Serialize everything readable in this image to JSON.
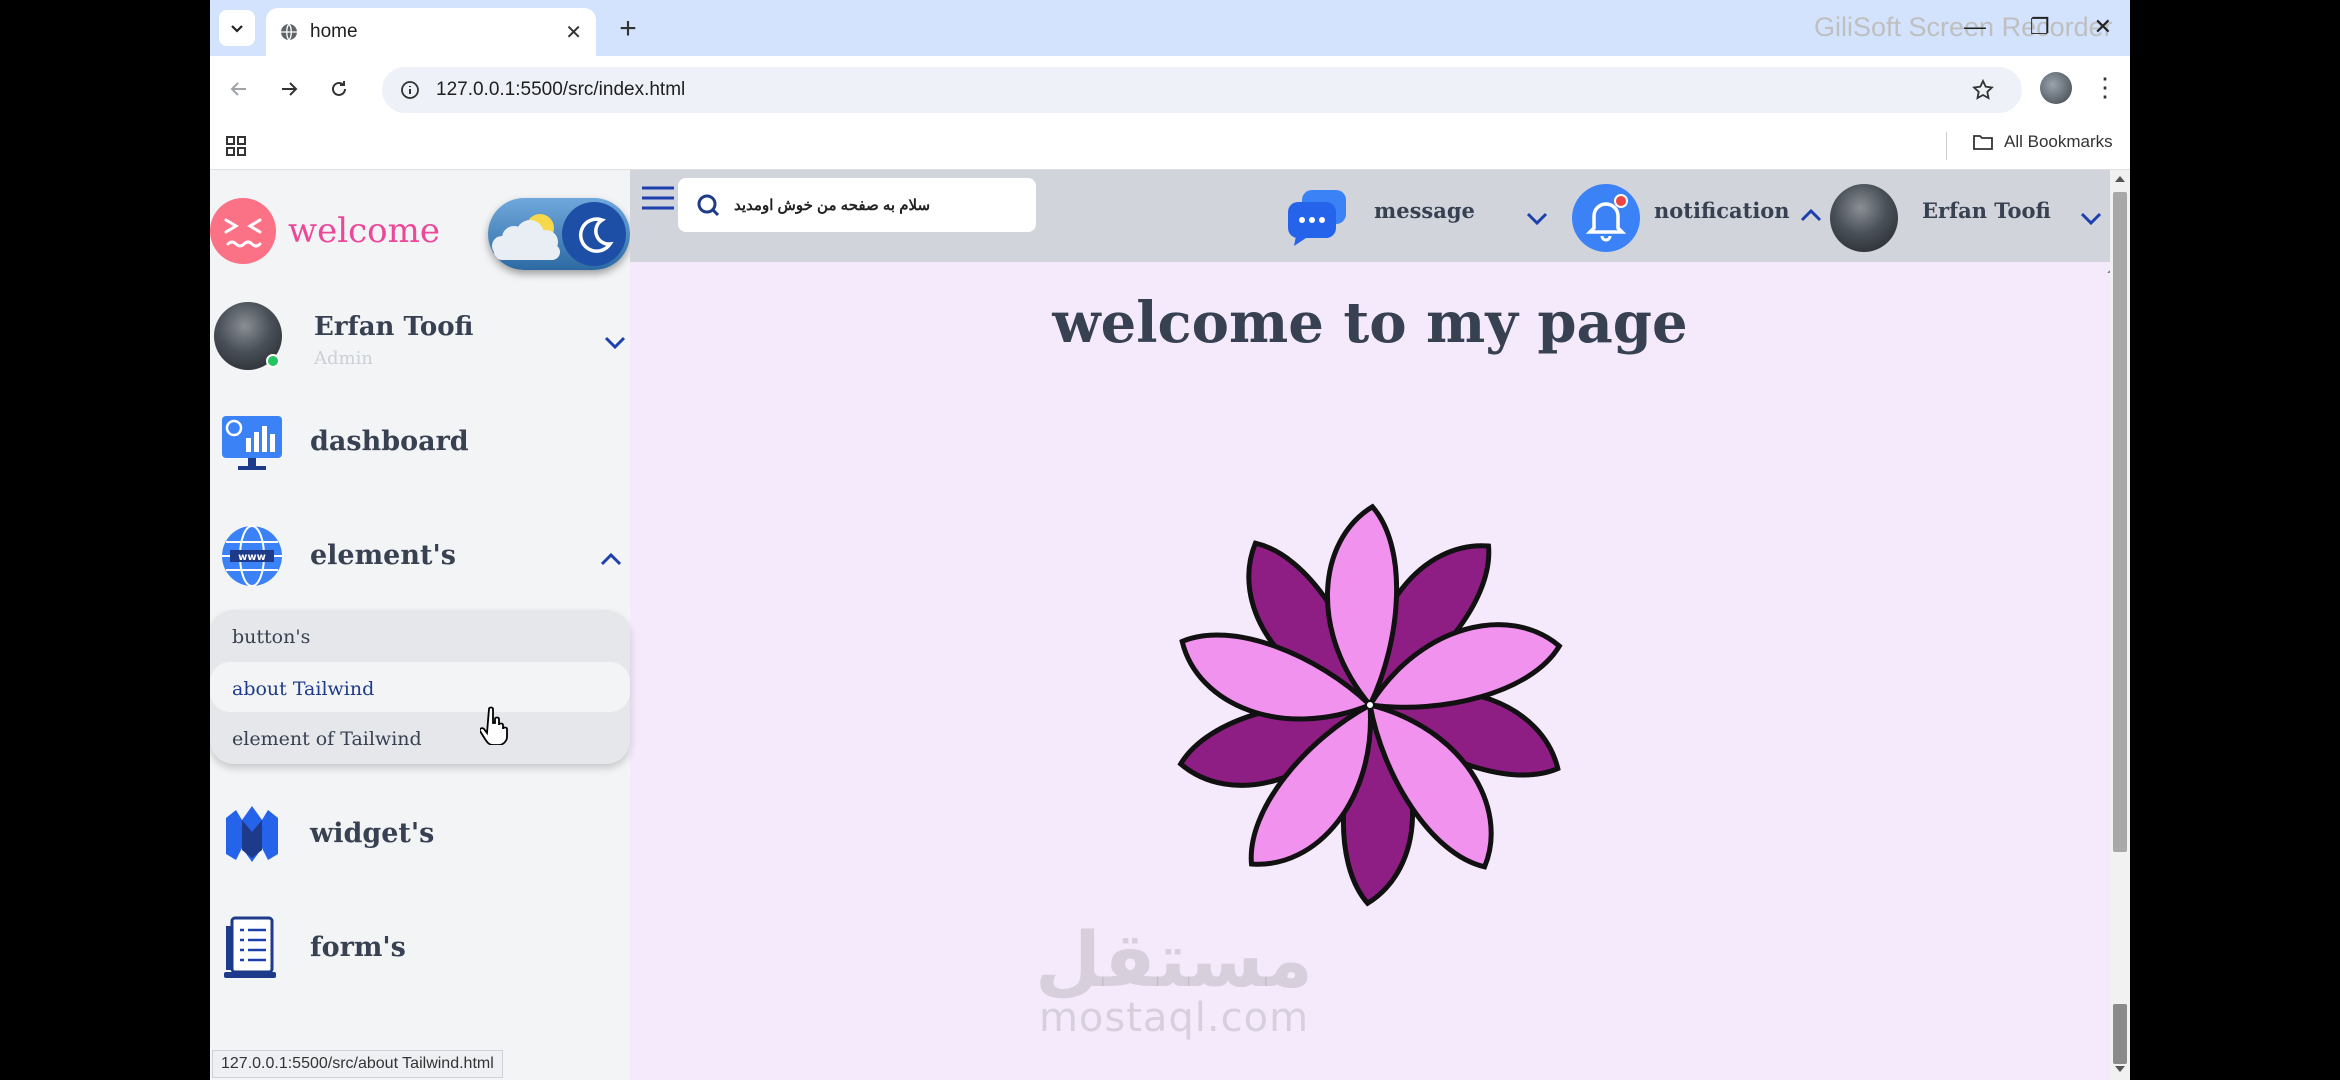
{
  "browser": {
    "tab_title": "home",
    "url": "127.0.0.1:5500/src/index.html",
    "bookmarks_label": "All Bookmarks",
    "status_url": "127.0.0.1:5500/src/about Tailwind.html",
    "watermark": "GiliSoft Screen Recorder"
  },
  "sidebar": {
    "brand": "welcome",
    "user": {
      "name": "Erfan Toofi",
      "role": "Admin",
      "status": "online"
    },
    "items": [
      {
        "label": "dashboard"
      },
      {
        "label": "element's",
        "expanded": true,
        "children": [
          {
            "label": "button's"
          },
          {
            "label": "about Tailwind",
            "active": true
          },
          {
            "label": "element of Tailwind"
          }
        ]
      },
      {
        "label": "widget's"
      },
      {
        "label": "form's"
      }
    ]
  },
  "topbar": {
    "search_text": "سلام به صفحه من خوش اومدید",
    "message_label": "message",
    "notification_label": "notification",
    "user_name": "Erfan Toofi"
  },
  "main": {
    "heading": "welcome to my page"
  },
  "watermark_site": {
    "arabic": "مستقل",
    "latin": "mostaql.com"
  },
  "colors": {
    "accent": "#1e40af",
    "brand_pink": "#ec4899",
    "petal_light": "#f192ef",
    "petal_dark": "#8e1d84",
    "page_bg": "#f4eafc"
  }
}
